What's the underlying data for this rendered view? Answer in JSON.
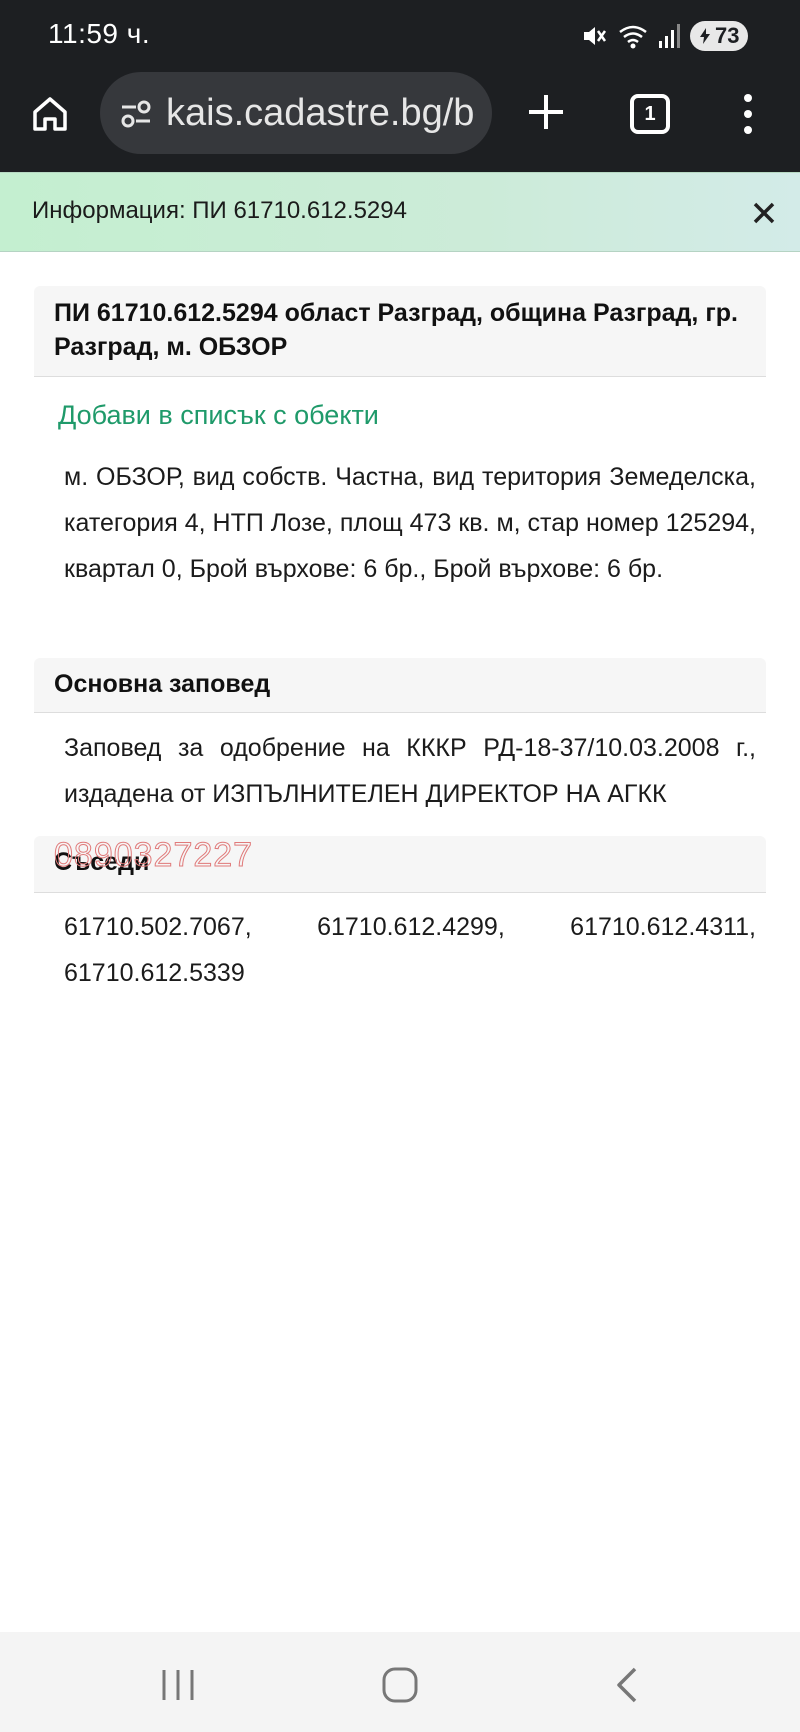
{
  "status_bar": {
    "time": "11:59 ч.",
    "battery": "73",
    "icons": [
      "mute-icon",
      "wifi-icon",
      "signal-icon",
      "battery-icon"
    ]
  },
  "browser": {
    "url": "kais.cadastre.bg/bg/Map",
    "tab_count": "1",
    "icons": [
      "home-icon",
      "site-settings-icon",
      "new-tab-plus-icon",
      "tabs-icon",
      "more-menu-icon"
    ]
  },
  "info_bar": {
    "text": "Информация: ПИ 61710.612.5294",
    "close_icon": "close-icon"
  },
  "property": {
    "title": "ПИ 61710.612.5294 област Разград, община Разград, гр. Разград, м. ОБЗОР",
    "add_link": "Добави в списък с обекти",
    "description": "м. ОБЗОР, вид собств. Частна, вид територия Земеделска, категория 4, НТП Лозе, площ 473 кв. м, стар номер 125294, квартал 0, Брой върхове: 6 бр., Брой върхове: 6 бр."
  },
  "order": {
    "heading": "Основна заповед",
    "text": "Заповед за одобрение на КККР РД-18-37/10.03.2008 г., издадена от ИЗПЪЛНИТЕЛЕН ДИРЕКТОР НА АГКК"
  },
  "neighbours": {
    "heading": "Съседи",
    "list": "61710.502.7067, 61710.612.4299, 61710.612.4311, 61710.612.5339"
  },
  "watermark": "0890327227",
  "nav_bar": {
    "icons": [
      "recent-apps-icon",
      "home-nav-icon",
      "back-icon"
    ]
  },
  "colors": {
    "top_bar": "#1d1f22",
    "url_box": "#36383c",
    "info_bar": "#c4efd0",
    "link": "#1f9a6a",
    "watermark": "#e07a7a"
  }
}
